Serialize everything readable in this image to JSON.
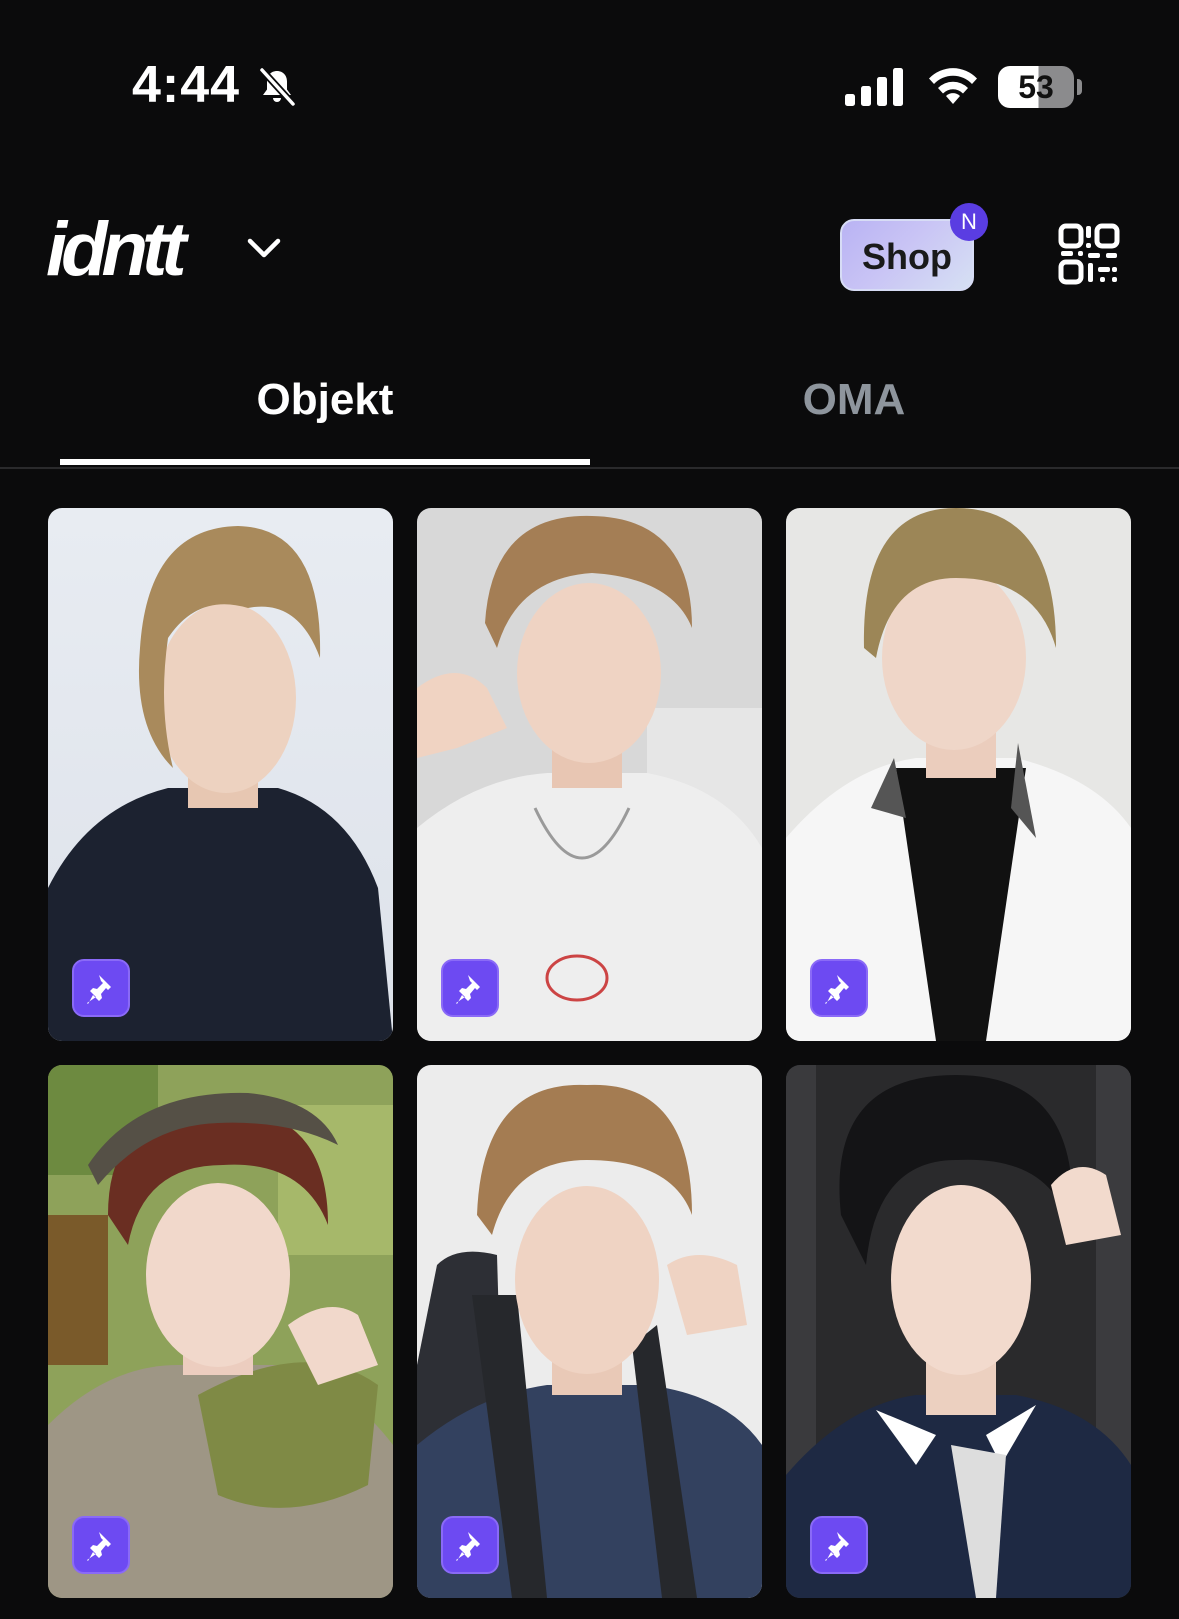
{
  "status_bar": {
    "time": "4:44",
    "battery": "53"
  },
  "header": {
    "brand": "idntt",
    "shop_label": "Shop",
    "shop_badge": "N"
  },
  "tabs": [
    {
      "label": "Objekt",
      "active": true
    },
    {
      "label": "OMA",
      "active": false
    }
  ],
  "colors": {
    "background": "#0b0b0c",
    "accent": "#6d4af2",
    "tab_inactive": "#8e959d",
    "badge": "#5a3de2"
  },
  "objekts": [
    {
      "icon": "pin-icon"
    },
    {
      "icon": "pin-icon"
    },
    {
      "icon": "pin-icon"
    },
    {
      "icon": "pin-icon"
    },
    {
      "icon": "pin-icon"
    },
    {
      "icon": "pin-icon"
    }
  ]
}
